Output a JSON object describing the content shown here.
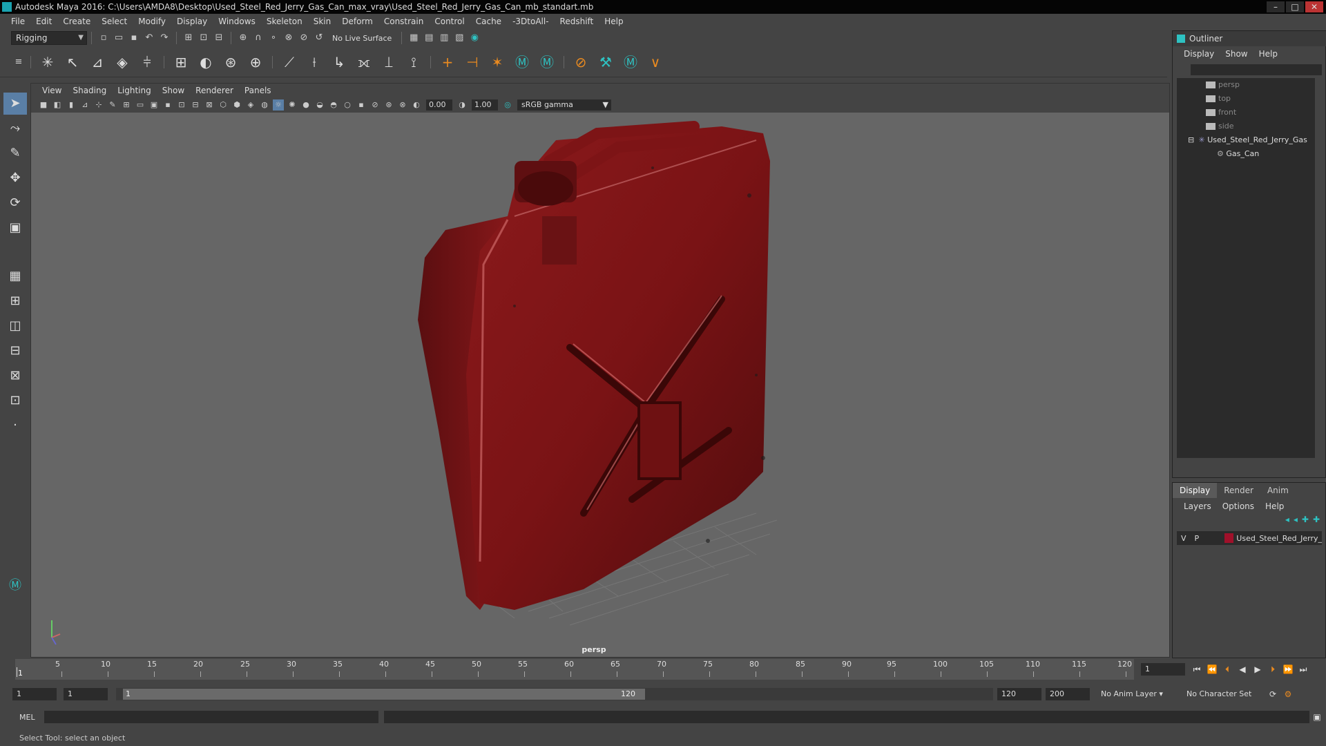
{
  "titlebar": {
    "title": "Autodesk Maya 2016: C:\\Users\\AMDA8\\Desktop\\Used_Steel_Red_Jerry_Gas_Can_max_vray\\Used_Steel_Red_Jerry_Gas_Can_mb_standart.mb"
  },
  "menubar": {
    "items": [
      "File",
      "Edit",
      "Create",
      "Select",
      "Modify",
      "Display",
      "Windows",
      "Skeleton",
      "Skin",
      "Deform",
      "Constrain",
      "Control",
      "Cache",
      "-3DtoAll-",
      "Redshift",
      "Help"
    ]
  },
  "toolbar": {
    "mode": "Rigging",
    "live_surface": "No Live Surface"
  },
  "viewport": {
    "menu": [
      "View",
      "Shading",
      "Lighting",
      "Show",
      "Renderer",
      "Panels"
    ],
    "exposure": "0.00",
    "gamma": "1.00",
    "color_space": "sRGB gamma",
    "camera": "persp"
  },
  "outliner": {
    "title": "Outliner",
    "menu": [
      "Display",
      "Show",
      "Help"
    ],
    "items": [
      {
        "label": "persp"
      },
      {
        "label": "top"
      },
      {
        "label": "front"
      },
      {
        "label": "side"
      },
      {
        "label": "Used_Steel_Red_Jerry_Gas"
      },
      {
        "label": "Gas_Can"
      }
    ]
  },
  "layers": {
    "tabs": [
      "Display",
      "Render",
      "Anim"
    ],
    "menu": [
      "Layers",
      "Options",
      "Help"
    ],
    "row": {
      "v": "V",
      "p": "P",
      "name": "Used_Steel_Red_Jerry_",
      "color": "#a0102a"
    }
  },
  "timeline": {
    "ticks": [
      "5",
      "10",
      "15",
      "20",
      "25",
      "30",
      "35",
      "40",
      "45",
      "50",
      "55",
      "60",
      "65",
      "70",
      "75",
      "80",
      "85",
      "90",
      "95",
      "100",
      "105",
      "110",
      "115",
      "120"
    ],
    "current_frame": "1",
    "frame_field": "1"
  },
  "range": {
    "start": "1",
    "play_start": "1",
    "slider_start": "1",
    "slider_end": "120",
    "play_end": "120",
    "end": "200",
    "anim_layer": "No Anim Layer",
    "char_set": "No Character Set"
  },
  "cmd": {
    "label": "MEL"
  },
  "status": {
    "text": "Select Tool: select an object"
  }
}
